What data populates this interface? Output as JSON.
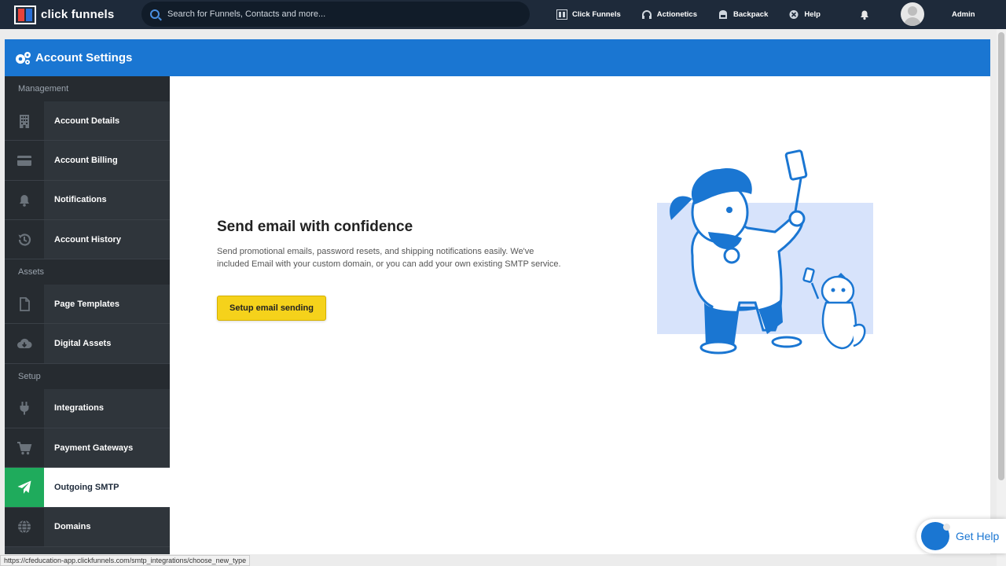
{
  "topnav": {
    "logo_text": "click funnels",
    "search_placeholder": "Search for Funnels, Contacts and more...",
    "links": [
      "Click Funnels",
      "Actionetics",
      "Backpack",
      "Help"
    ],
    "user_label": "Admin"
  },
  "card": {
    "title": "Account Settings"
  },
  "sidebar": {
    "sections": [
      "Management",
      "Assets",
      "Setup"
    ],
    "items": [
      {
        "label": "Account Details",
        "icon": "building-icon"
      },
      {
        "label": "Account Billing",
        "icon": "credit-card-icon"
      },
      {
        "label": "Notifications",
        "icon": "bell-icon"
      },
      {
        "label": "Account History",
        "icon": "history-icon"
      },
      {
        "label": "Page Templates",
        "icon": "file-icon"
      },
      {
        "label": "Digital Assets",
        "icon": "cloud-download-icon"
      },
      {
        "label": "Integrations",
        "icon": "plug-icon"
      },
      {
        "label": "Payment Gateways",
        "icon": "cart-icon"
      },
      {
        "label": "Outgoing SMTP",
        "icon": "paper-plane-icon",
        "active": true
      },
      {
        "label": "Domains",
        "icon": "globe-icon"
      }
    ]
  },
  "main": {
    "title": "Send email with confidence",
    "description": "Send promotional emails, password resets, and shipping notifications easily. We've included Email with your custom domain, or you can add your own existing SMTP service.",
    "button_label": "Setup email sending"
  },
  "status_url": "https://cfeducation-app.clickfunnels.com/smtp_integrations/choose_new_type",
  "help_widget_label": "Get Help",
  "colors": {
    "nav_bg": "#1e2a3a",
    "header_blue": "#1a76d2",
    "sidebar_bg": "#2f353b",
    "active_green": "#1fab5c",
    "button_yellow": "#f5d21b"
  }
}
